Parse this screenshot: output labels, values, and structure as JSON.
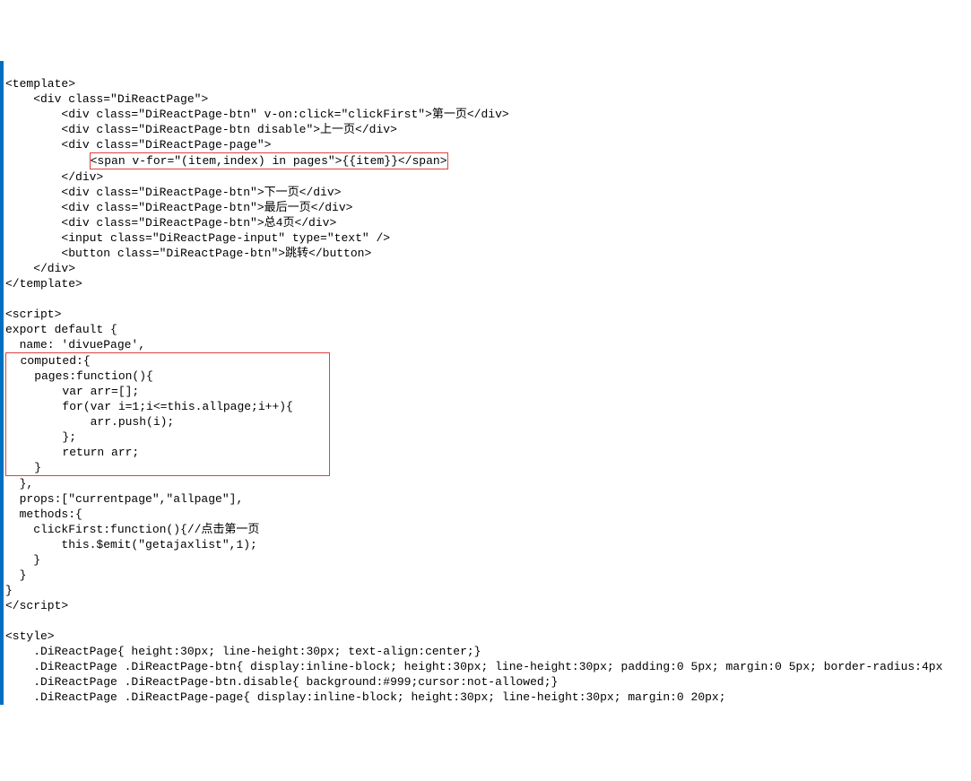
{
  "lines": {
    "l1": "<template>",
    "l2": "    <div class=\"DiReactPage\">",
    "l3": "        <div class=\"DiReactPage-btn\" v-on:click=\"clickFirst\">第一页</div>",
    "l4": "        <div class=\"DiReactPage-btn disable\">上一页</div>",
    "l5": "        <div class=\"DiReactPage-page\">",
    "l6_pre": "            ",
    "l6_box": "<span v-for=\"(item,index) in pages\">{{item}}</span>",
    "l7": "        </div>",
    "l8": "        <div class=\"DiReactPage-btn\">下一页</div>",
    "l9": "        <div class=\"DiReactPage-btn\">最后一页</div>",
    "l10": "        <div class=\"DiReactPage-btn\">总4页</div>",
    "l11": "        <input class=\"DiReactPage-input\" type=\"text\" />",
    "l12": "        <button class=\"DiReactPage-btn\">跳转</button>",
    "l13": "    </div>",
    "l14": "</template>",
    "l15": "",
    "l16": "<script>",
    "l17": "export default {",
    "l18": "  name: 'divuePage',",
    "l19": "  computed:{",
    "l20": "    pages:function(){",
    "l21": "        var arr=[];",
    "l22": "        for(var i=1;i<=this.allpage;i++){",
    "l23": "            arr.push(i);",
    "l24": "        };",
    "l25": "        return arr;",
    "l26": "    }",
    "l27": "  },",
    "l28": "  props:[\"currentpage\",\"allpage\"],",
    "l29": "  methods:{",
    "l30": "    clickFirst:function(){//点击第一页",
    "l31": "        this.$emit(\"getajaxlist\",1);",
    "l32": "    }",
    "l33": "  }",
    "l34": "}",
    "l35": "</script>",
    "l36": "",
    "l37": "<style>",
    "l38": "    .DiReactPage{ height:30px; line-height:30px; text-align:center;}",
    "l39": "    .DiReactPage .DiReactPage-btn{ display:inline-block; height:30px; line-height:30px; padding:0 5px; margin:0 5px; border-radius:4px",
    "l40": "    .DiReactPage .DiReactPage-btn.disable{ background:#999;cursor:not-allowed;}",
    "l41": "    .DiReactPage .DiReactPage-page{ display:inline-block; height:30px; line-height:30px; margin:0 20px;"
  }
}
